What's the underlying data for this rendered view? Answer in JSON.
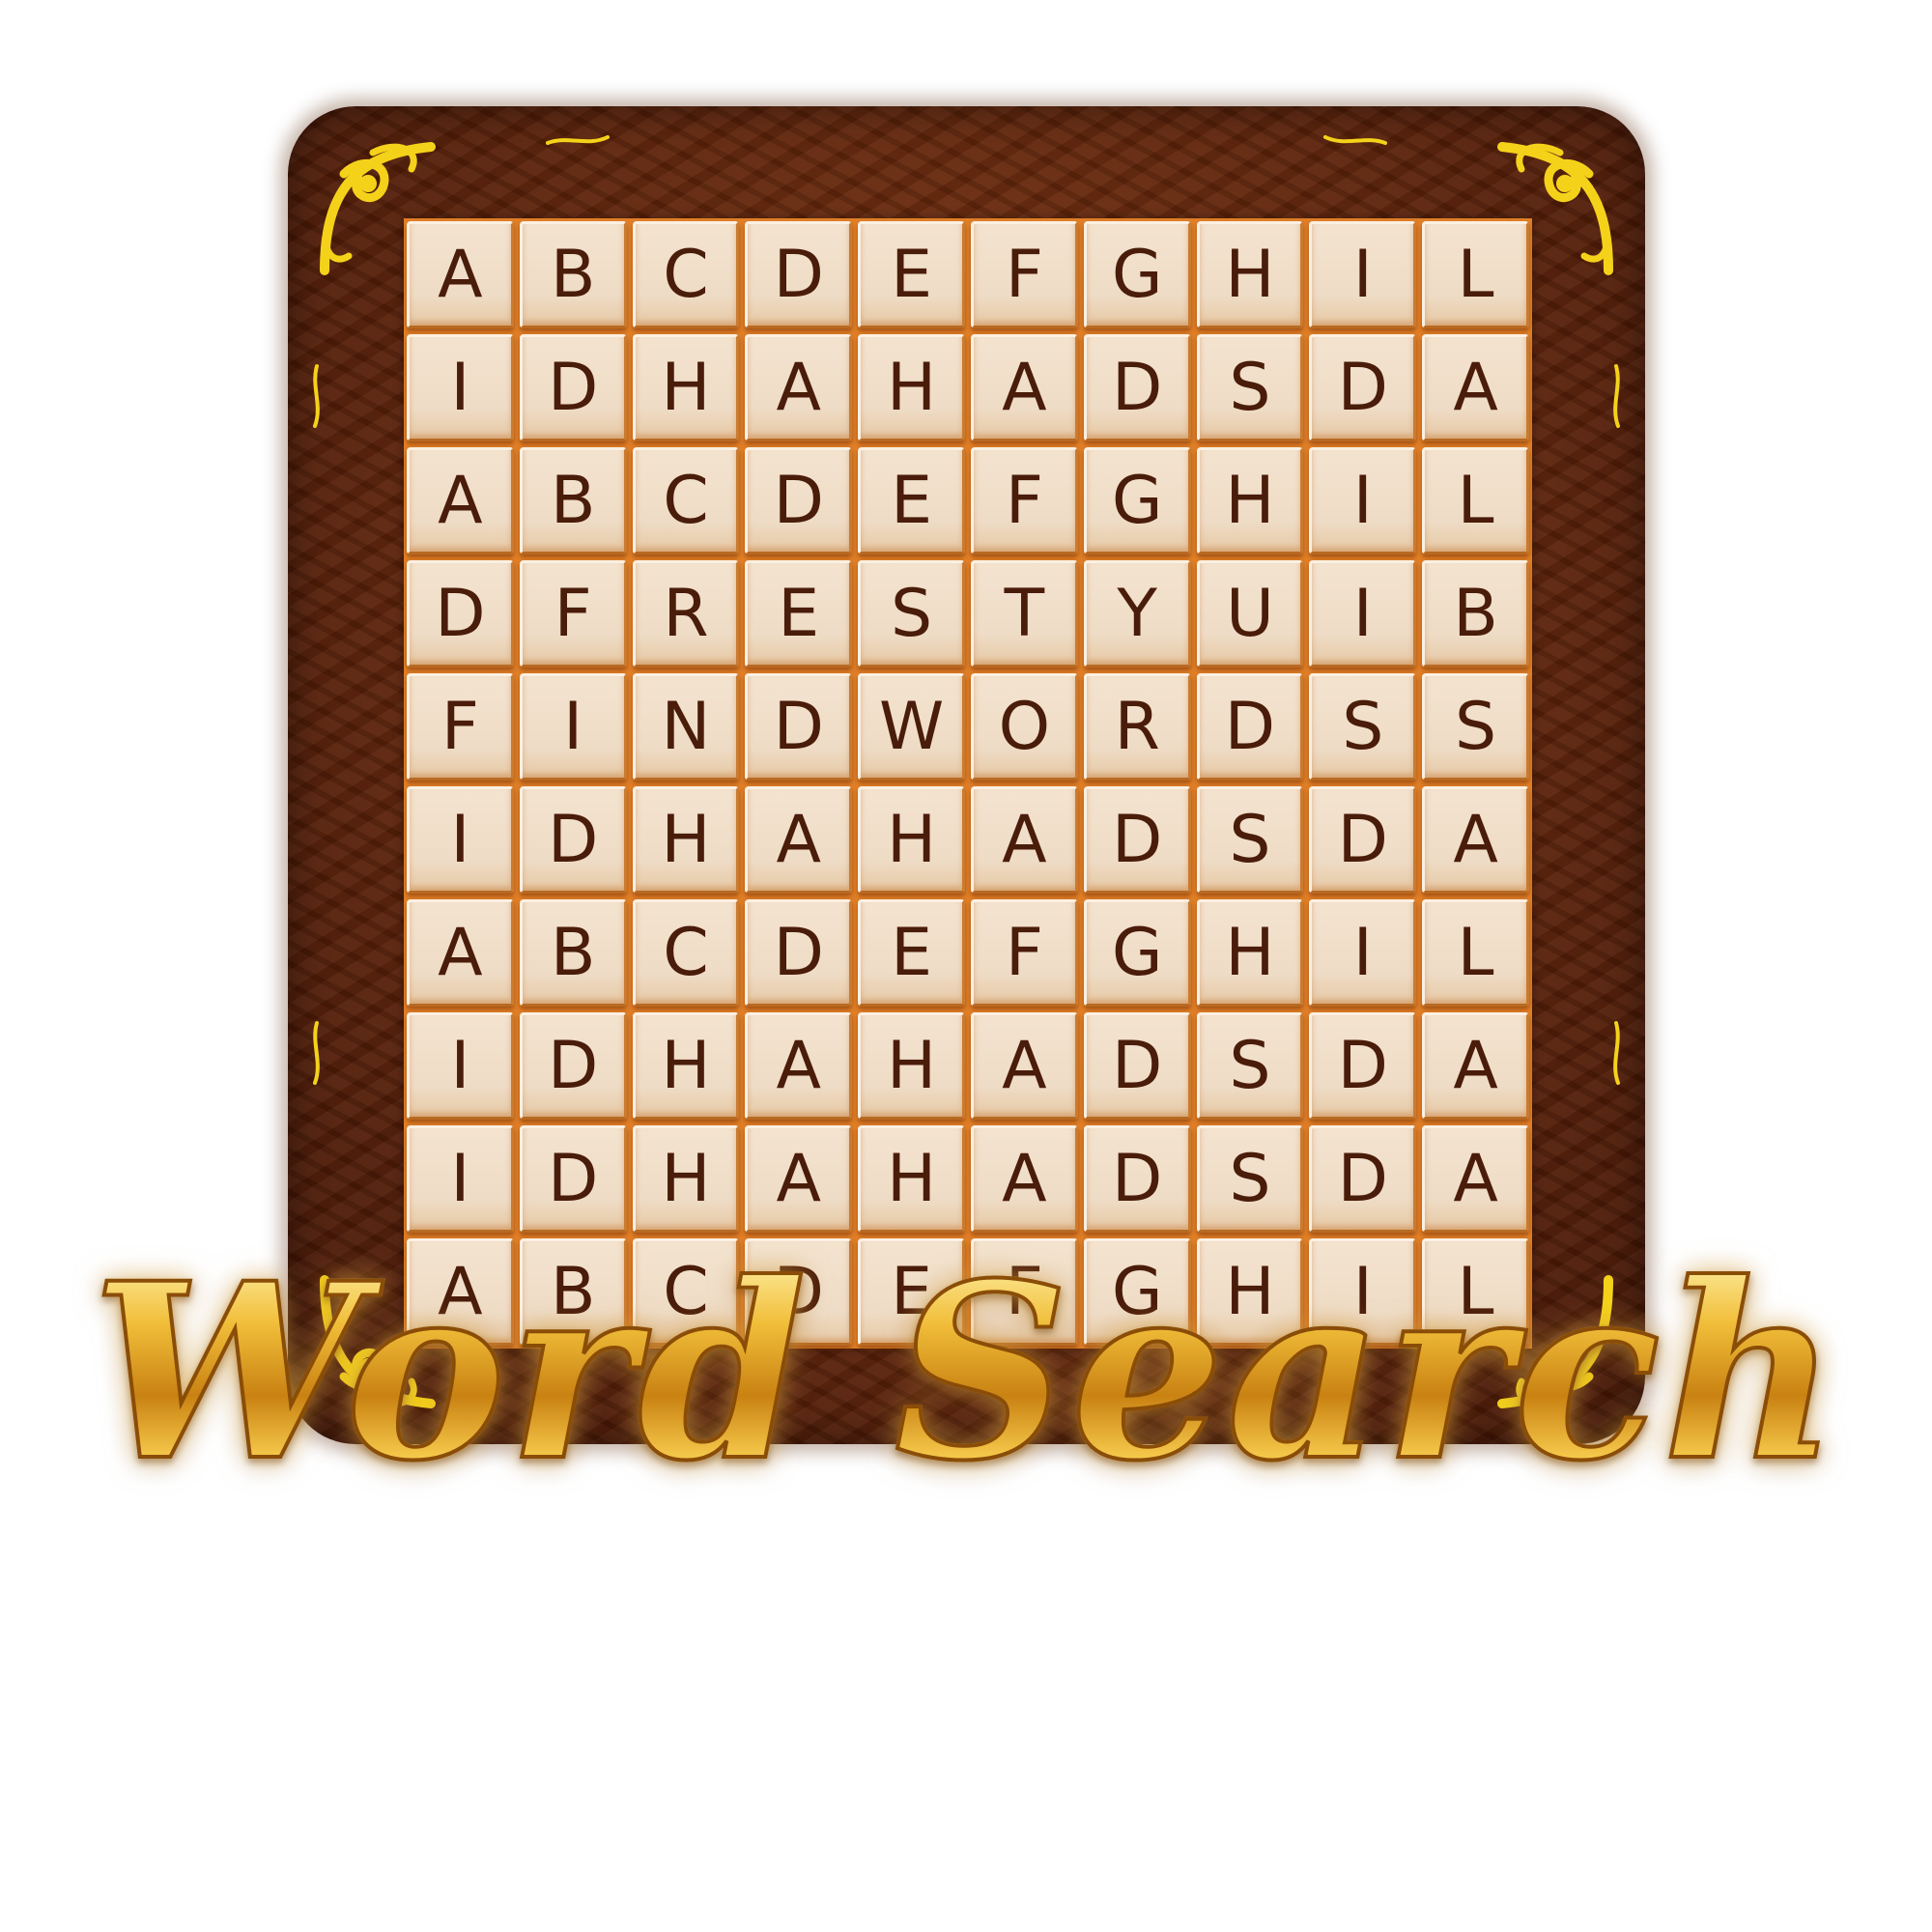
{
  "game": {
    "title": "Word Search",
    "grid": [
      [
        "A",
        "B",
        "C",
        "D",
        "E",
        "F",
        "G",
        "H",
        "I",
        "L"
      ],
      [
        "I",
        "D",
        "H",
        "A",
        "H",
        "A",
        "D",
        "S",
        "D",
        "A"
      ],
      [
        "A",
        "B",
        "C",
        "D",
        "E",
        "F",
        "G",
        "H",
        "I",
        "L"
      ],
      [
        "D",
        "F",
        "R",
        "E",
        "S",
        "T",
        "Y",
        "U",
        "I",
        "B"
      ],
      [
        "F",
        "I",
        "N",
        "D",
        "W",
        "O",
        "R",
        "D",
        "S",
        "S"
      ],
      [
        "I",
        "D",
        "H",
        "A",
        "H",
        "A",
        "D",
        "S",
        "D",
        "A"
      ],
      [
        "A",
        "B",
        "C",
        "D",
        "E",
        "F",
        "G",
        "H",
        "I",
        "L"
      ],
      [
        "I",
        "D",
        "H",
        "A",
        "H",
        "A",
        "D",
        "S",
        "D",
        "A"
      ],
      [
        "I",
        "D",
        "H",
        "A",
        "H",
        "A",
        "D",
        "S",
        "D",
        "A"
      ],
      [
        "A",
        "B",
        "C",
        "D",
        "E",
        "F",
        "G",
        "H",
        "I",
        "L"
      ]
    ],
    "colors": {
      "frame_wood": "#5e230a",
      "grid_gap": "#e07f27",
      "tile_face": "#f3e3cf",
      "letter": "#4a1c0a",
      "ornament_gold": "#f5d21a",
      "title_gold": "#d99418"
    },
    "ornaments": [
      "scroll-ornament-icon"
    ]
  }
}
